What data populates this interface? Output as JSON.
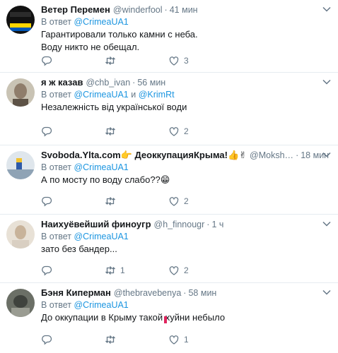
{
  "tweets": [
    {
      "name": "Ветер Перемен",
      "handle": "@winderfool",
      "time": "41 мин",
      "reply_prefix": "В ответ",
      "reply_to": [
        "@CrimeaUA1"
      ],
      "text": [
        "Гарантировали только камни с неба.",
        "Воду никто не обещал."
      ],
      "retweets": "",
      "likes": "3",
      "avatar_text": "ЭТО УКРАИНА"
    },
    {
      "name": "я ж казав",
      "handle": "@chb_ivan",
      "time": "56 мин",
      "reply_prefix": "В ответ",
      "reply_to": [
        "@CrimeaUA1",
        "@KrimRt"
      ],
      "reply_joiner": "и",
      "text": [
        "Незалежність від української води"
      ],
      "retweets": "",
      "likes": "2"
    },
    {
      "name": "Svoboda.Ylta.com👉 ДеоккупацияКрыма!👍✌",
      "handle": "@Moksh…",
      "time": "18 мин",
      "reply_prefix": "В ответ",
      "reply_to": [
        "@CrimeaUA1"
      ],
      "text": [
        "А по мосту по воду слабо??😁"
      ],
      "retweets": "",
      "likes": "2"
    },
    {
      "name": "Наихуёвейший финоугр",
      "handle": "@h_finnougr",
      "time": "1 ч",
      "reply_prefix": "В ответ",
      "reply_to": [
        "@CrimeaUA1"
      ],
      "text": [
        "зато без бандер..."
      ],
      "retweets": "1",
      "likes": "2"
    },
    {
      "name": "Бэня Киперман",
      "handle": "@thebravebenya",
      "time": "58 мин",
      "reply_prefix": "В ответ",
      "reply_to": [
        "@CrimeaUA1"
      ],
      "text": [
        "До оккупации в Крыму такой хуйни небыло"
      ],
      "retweets": "",
      "likes": "1"
    }
  ],
  "colors": {
    "link": "#1b95e0",
    "muted": "#657786",
    "divider": "#e6ecf0"
  },
  "icons": [
    "reply-icon",
    "retweet-icon",
    "like-icon",
    "chevron-down-icon"
  ]
}
